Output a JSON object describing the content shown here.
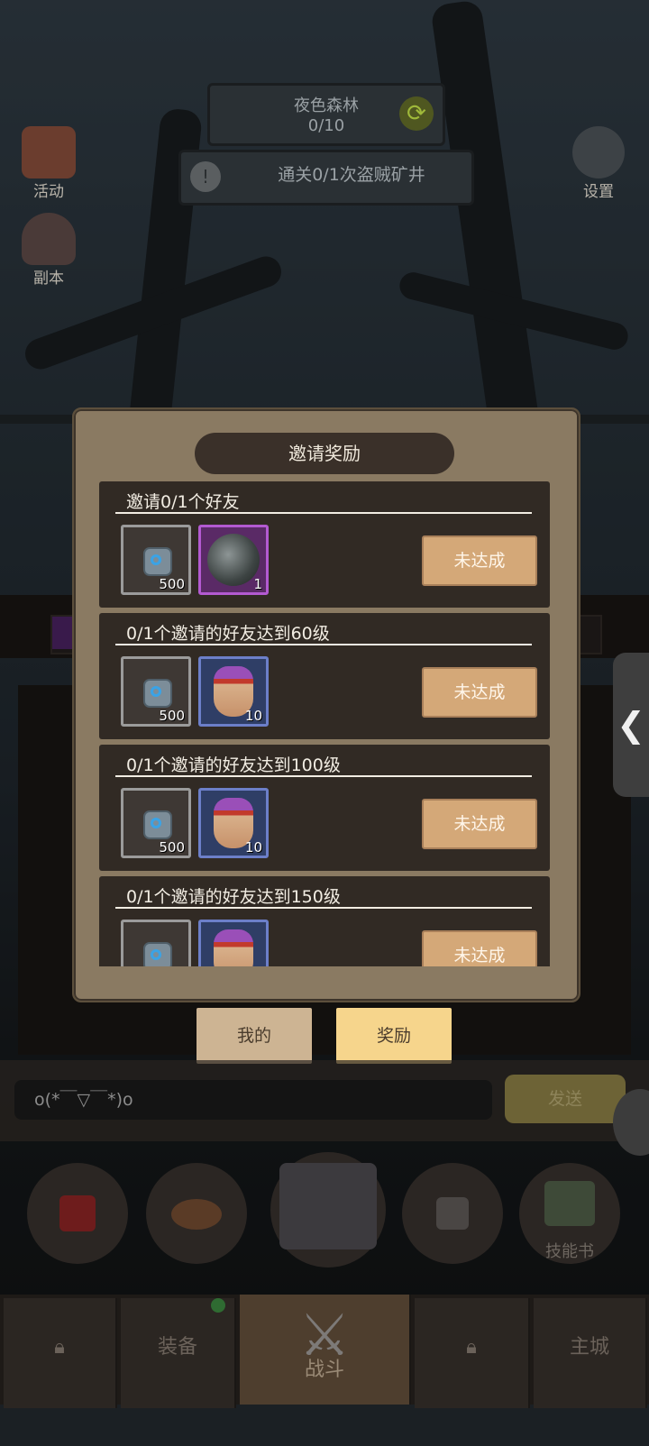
{
  "hud": {
    "map_name": "夜色森林",
    "map_progress": "0/10",
    "quest_text": "通关0/1次盗贼矿井",
    "quest_alert": "!"
  },
  "side": {
    "activity_label": "活动",
    "dungeon_label": "副本",
    "settings_label": "设置"
  },
  "dialog": {
    "title": "邀请奖励",
    "rewards": [
      {
        "title": "邀请0/1个好友",
        "item1_count": "500",
        "item2_count": "1",
        "status": "未达成"
      },
      {
        "title": "0/1个邀请的好友达到60级",
        "item1_count": "500",
        "item2_count": "10",
        "status": "未达成"
      },
      {
        "title": "0/1个邀请的好友达到100级",
        "item1_count": "500",
        "item2_count": "10",
        "status": "未达成"
      },
      {
        "title": "0/1个邀请的好友达到150级",
        "item1_count": "",
        "item2_count": "",
        "status": "未达成"
      }
    ]
  },
  "tabs": {
    "mine": "我的",
    "reward": "奖励"
  },
  "chat": {
    "input_value": "o(*￣▽￣*)o",
    "send_label": "发送"
  },
  "skill_book_label": "技能书",
  "nav": {
    "equip": "装备",
    "battle": "战斗",
    "city": "主城"
  },
  "side_tab_arrow": "❮"
}
